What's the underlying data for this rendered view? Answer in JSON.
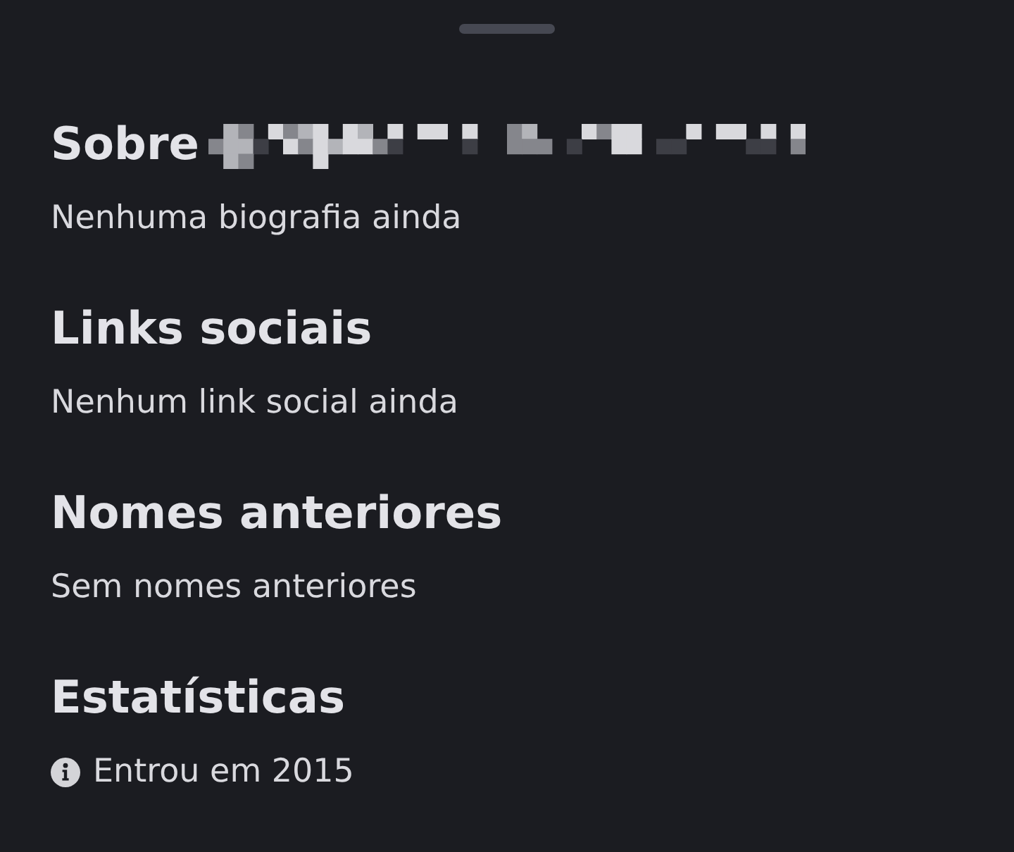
{
  "sections": [
    {
      "title": "Sobre",
      "redacted": true,
      "body": {
        "kind": "plain",
        "text": "Nenhuma biografia ainda"
      }
    },
    {
      "title": "Links sociais",
      "redacted": false,
      "body": {
        "kind": "plain",
        "text": "Nenhum link social ainda"
      }
    },
    {
      "title": "Nomes anteriores",
      "redacted": false,
      "body": {
        "kind": "plain",
        "text": "Sem nomes anteriores"
      }
    },
    {
      "title": "Estatísticas",
      "redacted": false,
      "body": {
        "kind": "info",
        "text": "Entrou em 2015"
      }
    }
  ]
}
